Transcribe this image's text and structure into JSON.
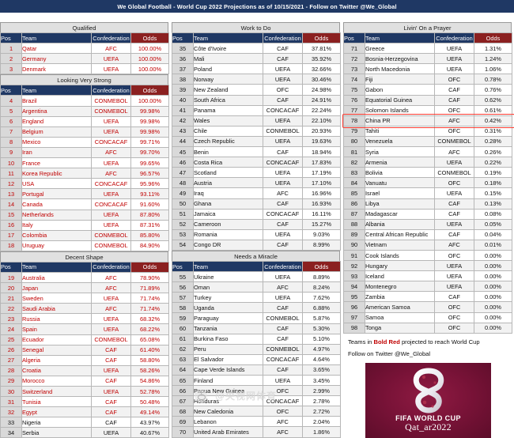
{
  "banner": {
    "title": "We Global Football - World Cup 2022 Projections as of 10/15/2021 - Follow on Twitter @We_Global"
  },
  "columns_header": {
    "pos": "Pos",
    "team": "Team",
    "confederation": "Confederation",
    "odds": "Odds"
  },
  "colors": {
    "header_blue": "#1f3864",
    "odds_red": "#8b2020",
    "qualify_text": "#c00000",
    "highlight_box": "#ff3b30",
    "section_band": "#e0e0e0"
  },
  "sections": [
    {
      "title": "Qualified",
      "column": 1,
      "rows": [
        {
          "pos": "1",
          "team": "Qatar",
          "conf": "AFC",
          "odds": "100.00%",
          "qualify": true
        },
        {
          "pos": "2",
          "team": "Germany",
          "conf": "UEFA",
          "odds": "100.00%",
          "qualify": true
        },
        {
          "pos": "3",
          "team": "Denmark",
          "conf": "UEFA",
          "odds": "100.00%",
          "qualify": true
        }
      ]
    },
    {
      "title": "Looking Very Strong",
      "column": 1,
      "rows": [
        {
          "pos": "4",
          "team": "Brazil",
          "conf": "CONMEBOL",
          "odds": "100.00%",
          "qualify": true
        },
        {
          "pos": "5",
          "team": "Argentina",
          "conf": "CONMEBOL",
          "odds": "99.98%",
          "qualify": true
        },
        {
          "pos": "6",
          "team": "England",
          "conf": "UEFA",
          "odds": "99.98%",
          "qualify": true
        },
        {
          "pos": "7",
          "team": "Belgium",
          "conf": "UEFA",
          "odds": "99.98%",
          "qualify": true
        },
        {
          "pos": "8",
          "team": "Mexico",
          "conf": "CONCACAF",
          "odds": "99.71%",
          "qualify": true
        },
        {
          "pos": "9",
          "team": "Iran",
          "conf": "AFC",
          "odds": "99.70%",
          "qualify": true
        },
        {
          "pos": "10",
          "team": "France",
          "conf": "UEFA",
          "odds": "99.65%",
          "qualify": true
        },
        {
          "pos": "11",
          "team": "Korea Republic",
          "conf": "AFC",
          "odds": "96.57%",
          "qualify": true
        },
        {
          "pos": "12",
          "team": "USA",
          "conf": "CONCACAF",
          "odds": "95.96%",
          "qualify": true
        },
        {
          "pos": "13",
          "team": "Portugal",
          "conf": "UEFA",
          "odds": "93.11%",
          "qualify": true
        },
        {
          "pos": "14",
          "team": "Canada",
          "conf": "CONCACAF",
          "odds": "91.60%",
          "qualify": true
        },
        {
          "pos": "15",
          "team": "Netherlands",
          "conf": "UEFA",
          "odds": "87.80%",
          "qualify": true
        },
        {
          "pos": "16",
          "team": "Italy",
          "conf": "UEFA",
          "odds": "87.31%",
          "qualify": true
        },
        {
          "pos": "17",
          "team": "Colombia",
          "conf": "CONMEBOL",
          "odds": "85.80%",
          "qualify": true
        },
        {
          "pos": "18",
          "team": "Uruguay",
          "conf": "CONMEBOL",
          "odds": "84.90%",
          "qualify": true
        }
      ]
    },
    {
      "title": "Decent Shape",
      "column": 1,
      "rows": [
        {
          "pos": "19",
          "team": "Australia",
          "conf": "AFC",
          "odds": "78.90%",
          "qualify": true
        },
        {
          "pos": "20",
          "team": "Japan",
          "conf": "AFC",
          "odds": "71.89%",
          "qualify": true
        },
        {
          "pos": "21",
          "team": "Sweden",
          "conf": "UEFA",
          "odds": "71.74%",
          "qualify": true
        },
        {
          "pos": "22",
          "team": "Saudi Arabia",
          "conf": "AFC",
          "odds": "71.74%",
          "qualify": true
        },
        {
          "pos": "23",
          "team": "Russia",
          "conf": "UEFA",
          "odds": "68.32%",
          "qualify": true
        },
        {
          "pos": "24",
          "team": "Spain",
          "conf": "UEFA",
          "odds": "68.22%",
          "qualify": true
        },
        {
          "pos": "25",
          "team": "Ecuador",
          "conf": "CONMEBOL",
          "odds": "65.08%",
          "qualify": true
        },
        {
          "pos": "26",
          "team": "Senegal",
          "conf": "CAF",
          "odds": "61.40%",
          "qualify": true
        },
        {
          "pos": "27",
          "team": "Algeria",
          "conf": "CAF",
          "odds": "58.80%",
          "qualify": true
        },
        {
          "pos": "28",
          "team": "Croatia",
          "conf": "UEFA",
          "odds": "58.26%",
          "qualify": true
        },
        {
          "pos": "29",
          "team": "Morocco",
          "conf": "CAF",
          "odds": "54.86%",
          "qualify": true
        },
        {
          "pos": "30",
          "team": "Switzerland",
          "conf": "UEFA",
          "odds": "52.78%",
          "qualify": true
        },
        {
          "pos": "31",
          "team": "Tunisia",
          "conf": "CAF",
          "odds": "50.48%",
          "qualify": true
        },
        {
          "pos": "32",
          "team": "Egypt",
          "conf": "CAF",
          "odds": "49.14%",
          "qualify": true
        },
        {
          "pos": "33",
          "team": "Nigeria",
          "conf": "CAF",
          "odds": "43.97%",
          "qualify": false
        },
        {
          "pos": "34",
          "team": "Serbia",
          "conf": "UEFA",
          "odds": "40.67%",
          "qualify": false
        }
      ]
    },
    {
      "title": "Work to Do",
      "column": 2,
      "rows": [
        {
          "pos": "35",
          "team": "Côte d'Ivoire",
          "conf": "CAF",
          "odds": "37.81%",
          "qualify": false
        },
        {
          "pos": "36",
          "team": "Mali",
          "conf": "CAF",
          "odds": "35.92%",
          "qualify": false
        },
        {
          "pos": "37",
          "team": "Poland",
          "conf": "UEFA",
          "odds": "32.66%",
          "qualify": false
        },
        {
          "pos": "38",
          "team": "Norway",
          "conf": "UEFA",
          "odds": "30.46%",
          "qualify": false
        },
        {
          "pos": "39",
          "team": "New Zealand",
          "conf": "OFC",
          "odds": "24.98%",
          "qualify": false
        },
        {
          "pos": "40",
          "team": "South Africa",
          "conf": "CAF",
          "odds": "24.91%",
          "qualify": false
        },
        {
          "pos": "41",
          "team": "Panama",
          "conf": "CONCACAF",
          "odds": "22.24%",
          "qualify": false
        },
        {
          "pos": "42",
          "team": "Wales",
          "conf": "UEFA",
          "odds": "22.10%",
          "qualify": false
        },
        {
          "pos": "43",
          "team": "Chile",
          "conf": "CONMEBOL",
          "odds": "20.93%",
          "qualify": false
        },
        {
          "pos": "44",
          "team": "Czech Republic",
          "conf": "UEFA",
          "odds": "19.63%",
          "qualify": false
        },
        {
          "pos": "45",
          "team": "Benin",
          "conf": "CAF",
          "odds": "18.94%",
          "qualify": false
        },
        {
          "pos": "46",
          "team": "Costa Rica",
          "conf": "CONCACAF",
          "odds": "17.83%",
          "qualify": false
        },
        {
          "pos": "47",
          "team": "Scotland",
          "conf": "UEFA",
          "odds": "17.19%",
          "qualify": false
        },
        {
          "pos": "48",
          "team": "Austria",
          "conf": "UEFA",
          "odds": "17.10%",
          "qualify": false
        },
        {
          "pos": "49",
          "team": "Iraq",
          "conf": "AFC",
          "odds": "16.96%",
          "qualify": false
        },
        {
          "pos": "50",
          "team": "Ghana",
          "conf": "CAF",
          "odds": "16.93%",
          "qualify": false
        },
        {
          "pos": "51",
          "team": "Jamaica",
          "conf": "CONCACAF",
          "odds": "16.11%",
          "qualify": false
        },
        {
          "pos": "52",
          "team": "Cameroon",
          "conf": "CAF",
          "odds": "15.27%",
          "qualify": false
        },
        {
          "pos": "53",
          "team": "Romania",
          "conf": "UEFA",
          "odds": "9.03%",
          "qualify": false
        },
        {
          "pos": "54",
          "team": "Congo DR",
          "conf": "CAF",
          "odds": "8.99%",
          "qualify": false
        }
      ]
    },
    {
      "title": "Needs a Miracle",
      "column": 2,
      "rows": [
        {
          "pos": "55",
          "team": "Ukraine",
          "conf": "UEFA",
          "odds": "8.89%",
          "qualify": false
        },
        {
          "pos": "56",
          "team": "Oman",
          "conf": "AFC",
          "odds": "8.24%",
          "qualify": false
        },
        {
          "pos": "57",
          "team": "Turkey",
          "conf": "UEFA",
          "odds": "7.62%",
          "qualify": false
        },
        {
          "pos": "58",
          "team": "Uganda",
          "conf": "CAF",
          "odds": "6.88%",
          "qualify": false
        },
        {
          "pos": "59",
          "team": "Paraguay",
          "conf": "CONMEBOL",
          "odds": "5.87%",
          "qualify": false
        },
        {
          "pos": "60",
          "team": "Tanzania",
          "conf": "CAF",
          "odds": "5.30%",
          "qualify": false
        },
        {
          "pos": "61",
          "team": "Burkina Faso",
          "conf": "CAF",
          "odds": "5.10%",
          "qualify": false
        },
        {
          "pos": "62",
          "team": "Peru",
          "conf": "CONMEBOL",
          "odds": "4.97%",
          "qualify": false
        },
        {
          "pos": "63",
          "team": "El Salvador",
          "conf": "CONCACAF",
          "odds": "4.64%",
          "qualify": false
        },
        {
          "pos": "64",
          "team": "Cape Verde Islands",
          "conf": "CAF",
          "odds": "3.65%",
          "qualify": false
        },
        {
          "pos": "65",
          "team": "Finland",
          "conf": "UEFA",
          "odds": "3.45%",
          "qualify": false
        },
        {
          "pos": "66",
          "team": "Papua New Guinea",
          "conf": "OFC",
          "odds": "2.99%",
          "qualify": false
        },
        {
          "pos": "67",
          "team": "Honduras",
          "conf": "CONCACAF",
          "odds": "2.78%",
          "qualify": false
        },
        {
          "pos": "68",
          "team": "New Caledonia",
          "conf": "OFC",
          "odds": "2.72%",
          "qualify": false
        },
        {
          "pos": "69",
          "team": "Lebanon",
          "conf": "AFC",
          "odds": "2.04%",
          "qualify": false
        },
        {
          "pos": "70",
          "team": "United Arab Emirates",
          "conf": "AFC",
          "odds": "1.86%",
          "qualify": false
        }
      ]
    },
    {
      "title": "Livin' On a Prayer",
      "column": 3,
      "rows": [
        {
          "pos": "71",
          "team": "Greece",
          "conf": "UEFA",
          "odds": "1.31%",
          "qualify": false
        },
        {
          "pos": "72",
          "team": "Bosnia-Herzegovina",
          "conf": "UEFA",
          "odds": "1.24%",
          "qualify": false
        },
        {
          "pos": "73",
          "team": "North Macedonia",
          "conf": "UEFA",
          "odds": "1.06%",
          "qualify": false
        },
        {
          "pos": "74",
          "team": "Fiji",
          "conf": "OFC",
          "odds": "0.78%",
          "qualify": false
        },
        {
          "pos": "75",
          "team": "Gabon",
          "conf": "CAF",
          "odds": "0.76%",
          "qualify": false
        },
        {
          "pos": "76",
          "team": "Equatorial Guinea",
          "conf": "CAF",
          "odds": "0.62%",
          "qualify": false
        },
        {
          "pos": "77",
          "team": "Solomon Islands",
          "conf": "OFC",
          "odds": "0.61%",
          "qualify": false
        },
        {
          "pos": "78",
          "team": "China PR",
          "conf": "AFC",
          "odds": "0.42%",
          "qualify": false,
          "highlight": true
        },
        {
          "pos": "79",
          "team": "Tahiti",
          "conf": "OFC",
          "odds": "0.31%",
          "qualify": false
        },
        {
          "pos": "80",
          "team": "Venezuela",
          "conf": "CONMEBOL",
          "odds": "0.28%",
          "qualify": false
        },
        {
          "pos": "81",
          "team": "Syria",
          "conf": "AFC",
          "odds": "0.26%",
          "qualify": false
        },
        {
          "pos": "82",
          "team": "Armenia",
          "conf": "UEFA",
          "odds": "0.22%",
          "qualify": false
        },
        {
          "pos": "83",
          "team": "Bolivia",
          "conf": "CONMEBOL",
          "odds": "0.19%",
          "qualify": false
        },
        {
          "pos": "84",
          "team": "Vanuatu",
          "conf": "OFC",
          "odds": "0.18%",
          "qualify": false
        },
        {
          "pos": "85",
          "team": "Israel",
          "conf": "UEFA",
          "odds": "0.15%",
          "qualify": false
        },
        {
          "pos": "86",
          "team": "Libya",
          "conf": "CAF",
          "odds": "0.13%",
          "qualify": false
        },
        {
          "pos": "87",
          "team": "Madagascar",
          "conf": "CAF",
          "odds": "0.08%",
          "qualify": false
        },
        {
          "pos": "88",
          "team": "Albania",
          "conf": "UEFA",
          "odds": "0.05%",
          "qualify": false
        },
        {
          "pos": "89",
          "team": "Central African Republic",
          "conf": "CAF",
          "odds": "0.04%",
          "qualify": false
        },
        {
          "pos": "90",
          "team": "Vietnam",
          "conf": "AFC",
          "odds": "0.01%",
          "qualify": false
        },
        {
          "pos": "91",
          "team": "Cook Islands",
          "conf": "OFC",
          "odds": "0.00%",
          "qualify": false
        },
        {
          "pos": "92",
          "team": "Hungary",
          "conf": "UEFA",
          "odds": "0.00%",
          "qualify": false
        },
        {
          "pos": "93",
          "team": "Iceland",
          "conf": "UEFA",
          "odds": "0.00%",
          "qualify": false
        },
        {
          "pos": "94",
          "team": "Montenegro",
          "conf": "UEFA",
          "odds": "0.00%",
          "qualify": false
        },
        {
          "pos": "95",
          "team": "Zambia",
          "conf": "CAF",
          "odds": "0.00%",
          "qualify": false
        },
        {
          "pos": "96",
          "team": "American Samoa",
          "conf": "OFC",
          "odds": "0.00%",
          "qualify": false
        },
        {
          "pos": "97",
          "team": "Samoa",
          "conf": "OFC",
          "odds": "0.00%",
          "qualify": false
        },
        {
          "pos": "98",
          "team": "Tonga",
          "conf": "OFC",
          "odds": "0.00%",
          "qualify": false
        }
      ]
    }
  ],
  "footer": {
    "legend_pre": "Teams in ",
    "legend_em": "Bold Red",
    "legend_post": " projected to reach World Cup",
    "twitter": "Follow on Twitter @We_Global"
  },
  "logo": {
    "line1": "FIFA WORLD CUP",
    "line2": "Qat_ar2022"
  },
  "watermark": {
    "text": "@央视网体育"
  }
}
